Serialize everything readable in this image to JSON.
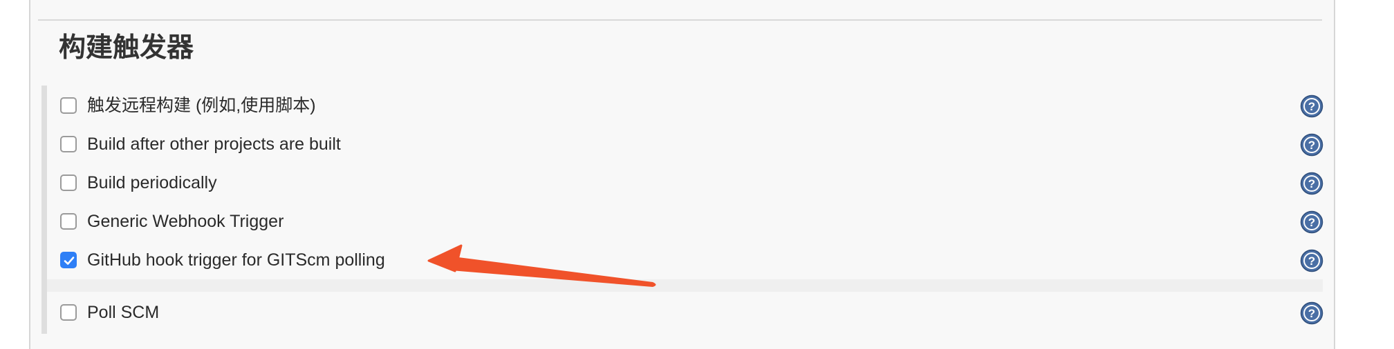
{
  "section": {
    "title": "构建触发器"
  },
  "triggers": [
    {
      "label": "触发远程构建 (例如,使用脚本)",
      "checked": false
    },
    {
      "label": "Build after other projects are built",
      "checked": false
    },
    {
      "label": "Build periodically",
      "checked": false
    },
    {
      "label": "Generic Webhook Trigger",
      "checked": false
    },
    {
      "label": "GitHub hook trigger for GITScm polling",
      "checked": true
    },
    {
      "label": "Poll SCM",
      "checked": false
    }
  ],
  "icons": {
    "help": "help-question-icon",
    "annotation": "red-arrow-annotation"
  },
  "colors": {
    "checkbox_checked": "#2e7ff6",
    "help_icon": "#4a6fa5",
    "arrow": "#f0522a",
    "panel_bg": "#f8f8f8"
  }
}
